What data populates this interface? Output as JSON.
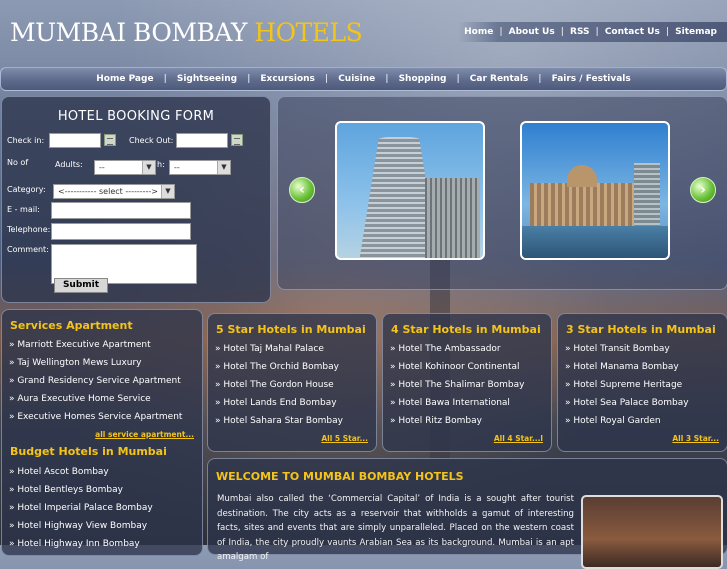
{
  "header": {
    "logo_main": "MUMBAI BOMBAY",
    "logo_accent": "HOTELS",
    "top_links": [
      "Home",
      "About Us",
      "RSS",
      "Contact Us",
      "Sitemap"
    ]
  },
  "main_nav": [
    "Home Page",
    "Sightseeing",
    "Excursions",
    "Cuisine",
    "Shopping",
    "Car Rentals",
    "Fairs / Festivals"
  ],
  "booking_form": {
    "title": "HOTEL BOOKING FORM",
    "check_in_label": "Check in:",
    "check_out_label": "Check Out:",
    "no_of_label": "No of",
    "adults_label": "Adults:",
    "children_label": "h:",
    "adults_value": "--",
    "children_value": "--",
    "category_label": "Category:",
    "category_value": "<----------- select --------->",
    "email_label": "E - mail:",
    "telephone_label": "Telephone:",
    "comment_label": "Comment:",
    "submit_label": "Submit"
  },
  "gallery": {
    "prev_icon": "left-arrow-icon",
    "next_icon": "right-arrow-icon"
  },
  "services": {
    "title": "Services Apartment",
    "items": [
      "» Marriott Executive Apartment",
      "» Taj Wellington Mews Luxury",
      "» Grand Residency Service Apartment",
      "» Aura Executive Home Service",
      "» Executive Homes Service Apartment"
    ],
    "more": "all service apartment..."
  },
  "budget": {
    "title": "Budget Hotels in Mumbai",
    "items": [
      "» Hotel Ascot Bombay",
      "» Hotel Bentleys Bombay",
      "» Hotel Imperial Palace Bombay",
      "» Hotel Highway View Bombay",
      "» Hotel Highway Inn Bombay"
    ]
  },
  "five_star": {
    "title": "5 Star Hotels in Mumbai",
    "items": [
      "» Hotel Taj Mahal Palace",
      "» Hotel The Orchid Bombay",
      "» Hotel The Gordon House",
      "» Hotel Lands End Bombay",
      "» Hotel Sahara Star Bombay"
    ],
    "more": "All 5 Star..."
  },
  "four_star": {
    "title": "4 Star Hotels in Mumbai",
    "items": [
      "» Hotel The Ambassador",
      "» Hotel Kohinoor Continental",
      "» Hotel The Shalimar Bombay",
      "» Hotel Bawa International",
      "» Hotel Ritz Bombay"
    ],
    "more": "All 4 Star...l"
  },
  "three_star": {
    "title": "3 Star Hotels in Mumbai",
    "items": [
      "» Hotel Transit Bombay",
      "» Hotel Manama Bombay",
      "» Hotel Supreme Heritage",
      "» Hotel Sea Palace Bombay",
      "» Hotel Royal Garden"
    ],
    "more": "All 3 Star..."
  },
  "welcome": {
    "title": "WELCOME TO MUMBAI BOMBAY HOTELS",
    "text": "Mumbai also called the ‘Commercial Capital’ of India is a sought after tourist destination. The city acts as a reservoir that withholds a gamut of interesting facts, sites and events that are simply unparalleled. Placed on the western coast of India, the city proudly vaunts Arabian Sea as its background. Mumbai is an apt amalgam of"
  }
}
